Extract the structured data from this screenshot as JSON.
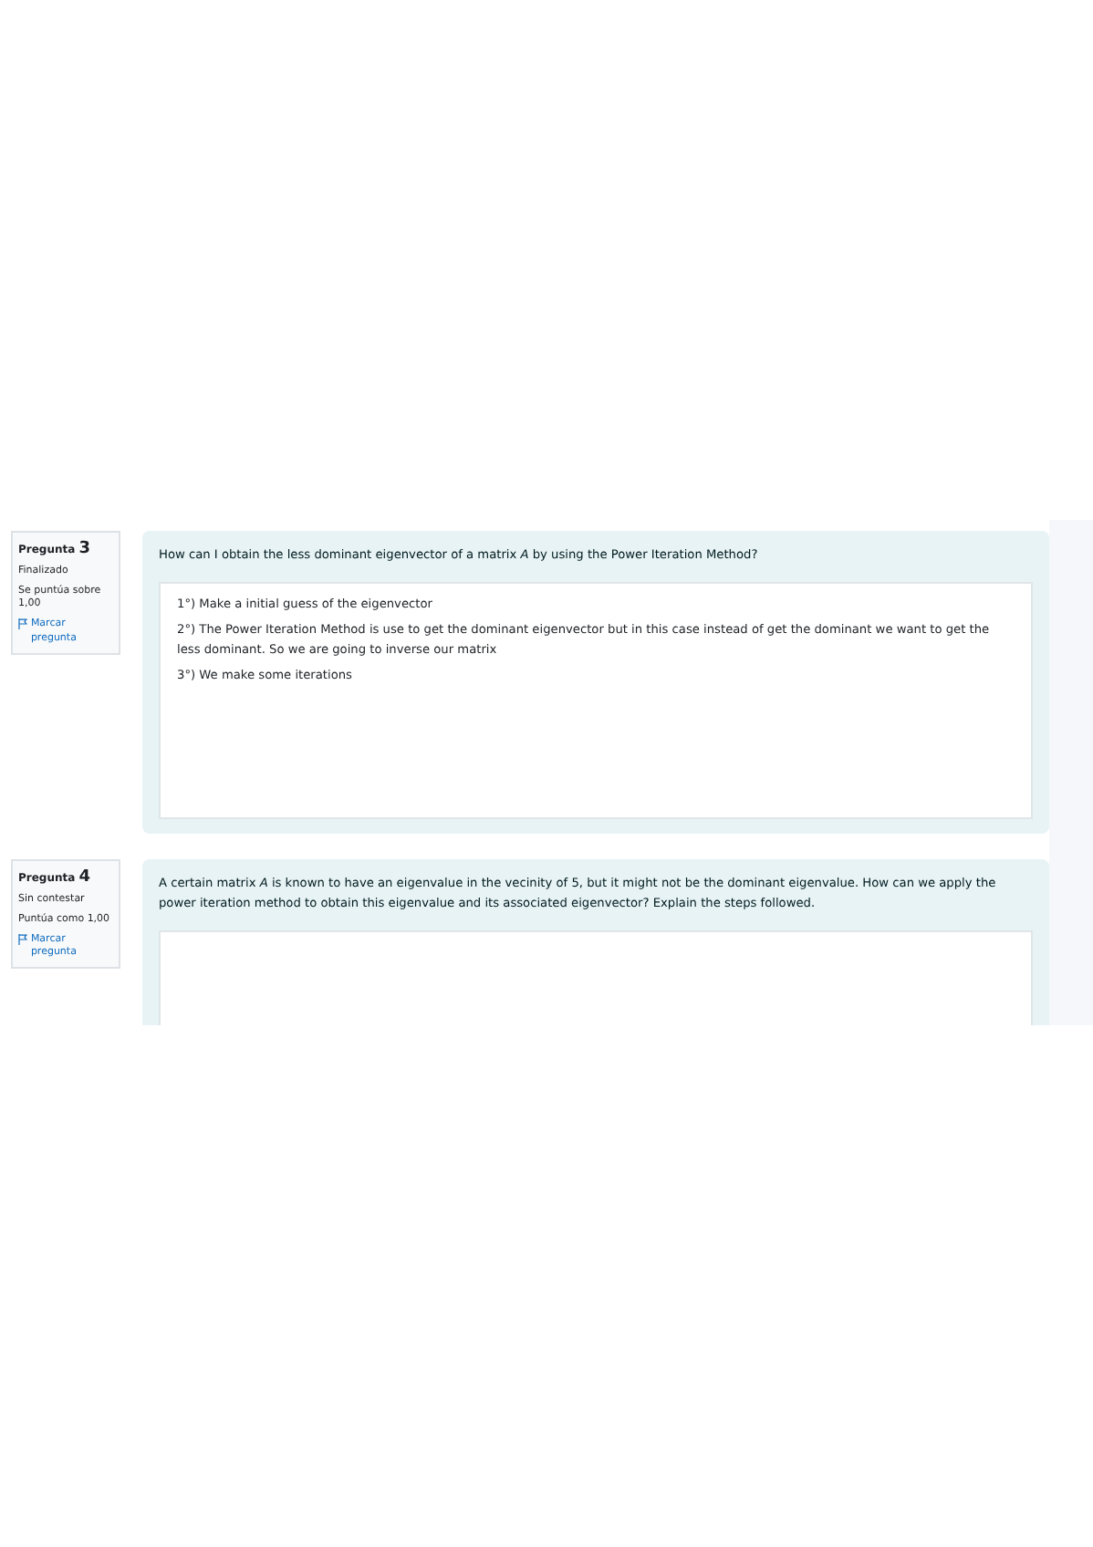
{
  "questions": [
    {
      "number_label": "Pregunta",
      "number": "3",
      "state": "Finalizado",
      "grade": "Se puntúa sobre 1,00",
      "flag_label": "Marcar pregunta",
      "flagged": false,
      "text": "How can I obtain the less dominant eigenvector of a matrix *A* by using the Power Iteration Method?",
      "answer_lines": [
        "1°) Make a initial guess of the eigenvector",
        "2°) The Power Iteration Method is use to get the dominant eigenvector but in this case instead of get the dominant we want to get the less dominant. So we are going to inverse our matrix",
        "3°) We make some iterations"
      ]
    },
    {
      "number_label": "Pregunta",
      "number": "4",
      "state": "Sin contestar",
      "grade": "Puntúa como 1,00",
      "flag_label": "Marcar pregunta",
      "flagged": false,
      "text": "A certain matrix *A* is known to have an eigenvalue in the vecinity of 5, but it might not be the dominant eigenvalue. How can we apply the power iteration method to obtain this eigenvalue and its associated eigenvector? Explain the steps followed."
    }
  ]
}
